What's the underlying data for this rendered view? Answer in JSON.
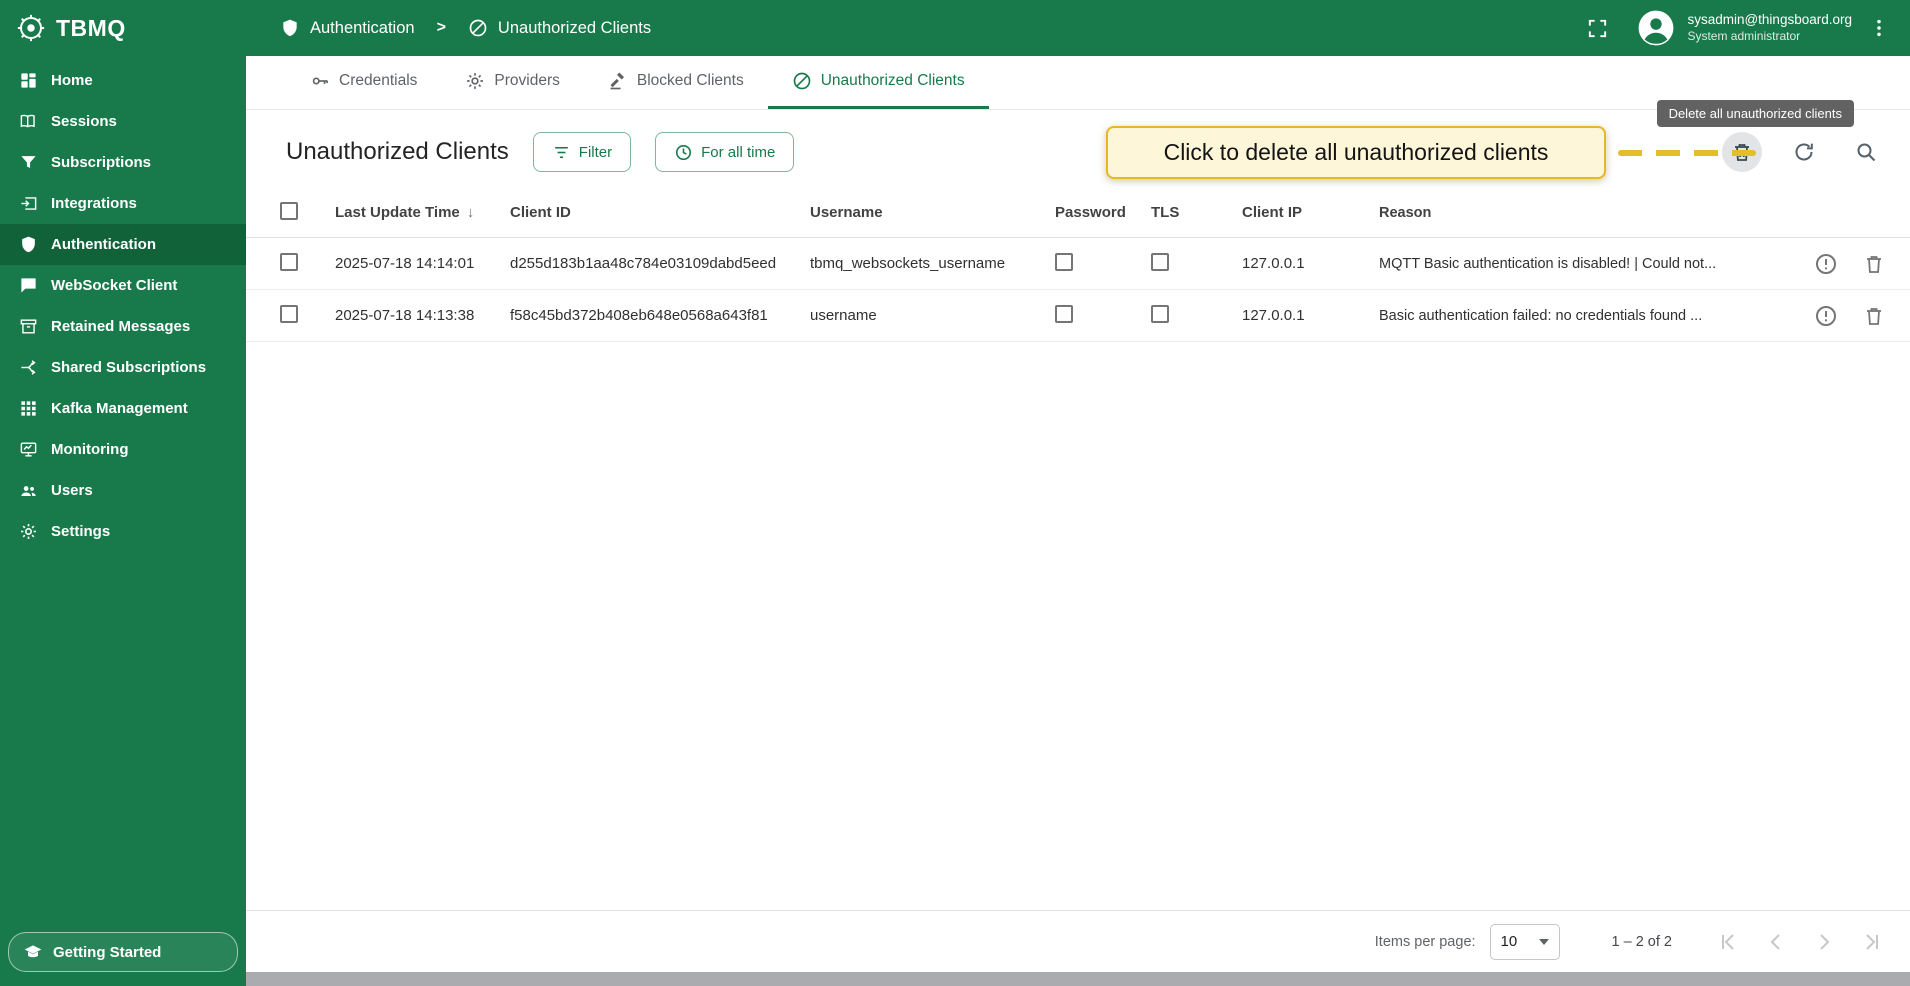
{
  "app": {
    "name": "TBMQ"
  },
  "topbar": {
    "breadcrumb": [
      {
        "label": "Authentication"
      },
      {
        "label": "Unauthorized Clients"
      }
    ],
    "separator": ">",
    "user_email": "sysadmin@thingsboard.org",
    "user_role": "System administrator"
  },
  "sidebar": {
    "items": [
      {
        "label": "Home"
      },
      {
        "label": "Sessions"
      },
      {
        "label": "Subscriptions"
      },
      {
        "label": "Integrations"
      },
      {
        "label": "Authentication"
      },
      {
        "label": "WebSocket Client"
      },
      {
        "label": "Retained Messages"
      },
      {
        "label": "Shared Subscriptions"
      },
      {
        "label": "Kafka Management"
      },
      {
        "label": "Monitoring"
      },
      {
        "label": "Users"
      },
      {
        "label": "Settings"
      }
    ],
    "getting_started": "Getting Started"
  },
  "tabs": [
    {
      "label": "Credentials"
    },
    {
      "label": "Providers"
    },
    {
      "label": "Blocked Clients"
    },
    {
      "label": "Unauthorized Clients"
    }
  ],
  "toolbar": {
    "title": "Unauthorized Clients",
    "filter_label": "Filter",
    "time_range_label": "For all time"
  },
  "overlay": {
    "tooltip": "Delete all unauthorized clients",
    "callout": "Click to delete all unauthorized clients"
  },
  "table": {
    "columns": {
      "time": "Last Update Time",
      "client_id": "Client ID",
      "username": "Username",
      "password": "Password",
      "tls": "TLS",
      "client_ip": "Client IP",
      "reason": "Reason"
    },
    "rows": [
      {
        "time": "2025-07-18 14:14:01",
        "client_id": "d255d183b1aa48c784e03109dabd5eed",
        "username": "tbmq_websockets_username",
        "client_ip": "127.0.0.1",
        "reason": "MQTT Basic authentication is disabled! | Could not..."
      },
      {
        "time": "2025-07-18 14:13:38",
        "client_id": "f58c45bd372b408eb648e0568a643f81",
        "username": "username",
        "client_ip": "127.0.0.1",
        "reason": "Basic authentication failed: no credentials found ..."
      }
    ]
  },
  "pagination": {
    "items_per_page_label": "Items per page:",
    "page_size": "10",
    "range_label": "1 – 2 of 2"
  },
  "colors": {
    "brand_green": "#187a4b",
    "active_item_green": "#116239",
    "callout_border": "#e6b825",
    "callout_bg": "#fdf6d9"
  }
}
